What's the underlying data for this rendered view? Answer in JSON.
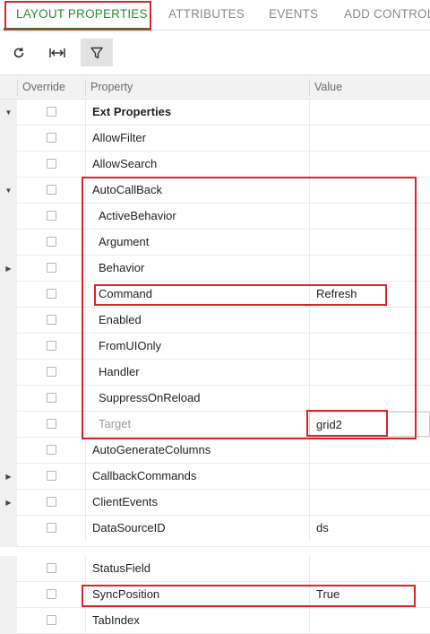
{
  "tabs": [
    {
      "label": "LAYOUT PROPERTIES",
      "active": true
    },
    {
      "label": "ATTRIBUTES",
      "active": false
    },
    {
      "label": "EVENTS",
      "active": false
    },
    {
      "label": "ADD CONTROLS",
      "active": false
    }
  ],
  "toolbar": {
    "buttons": [
      {
        "icon": "refresh-icon"
      },
      {
        "icon": "fit-width-icon"
      },
      {
        "icon": "filter-icon",
        "pressed": true
      }
    ]
  },
  "grid": {
    "columns": {
      "override": "Override",
      "property": "Property",
      "value": "Value"
    },
    "rows": [
      {
        "property": "Ext Properties",
        "value": "",
        "expander": "expanded",
        "bold": true
      },
      {
        "property": "AllowFilter",
        "value": ""
      },
      {
        "property": "AllowSearch",
        "value": ""
      },
      {
        "property": "AutoCallBack",
        "value": "",
        "expander": "expanded"
      },
      {
        "property": "ActiveBehavior",
        "value": "",
        "child": true
      },
      {
        "property": "Argument",
        "value": "",
        "child": true
      },
      {
        "property": "Behavior",
        "value": "",
        "child": true,
        "expander": "collapsed"
      },
      {
        "property": "Command",
        "value": "Refresh",
        "child": true
      },
      {
        "property": "Enabled",
        "value": "",
        "child": true
      },
      {
        "property": "FromUIOnly",
        "value": "",
        "child": true
      },
      {
        "property": "Handler",
        "value": "",
        "child": true
      },
      {
        "property": "SuppressOnReload",
        "value": "",
        "child": true
      },
      {
        "property": "Target",
        "value": "grid2",
        "child": true,
        "muted": true,
        "editing": true
      },
      {
        "property": "AutoGenerateColumns",
        "value": ""
      },
      {
        "property": "CallbackCommands",
        "value": "",
        "expander": "collapsed"
      },
      {
        "property": "ClientEvents",
        "value": "",
        "expander": "collapsed"
      },
      {
        "property": "DataSourceID",
        "value": "ds"
      },
      {
        "property": "StatusField",
        "value": ""
      },
      {
        "property": "SyncPosition",
        "value": "True"
      },
      {
        "property": "TabIndex",
        "value": ""
      }
    ]
  },
  "colors": {
    "accent": "#2e8b2e",
    "highlight": "#d9242b"
  }
}
